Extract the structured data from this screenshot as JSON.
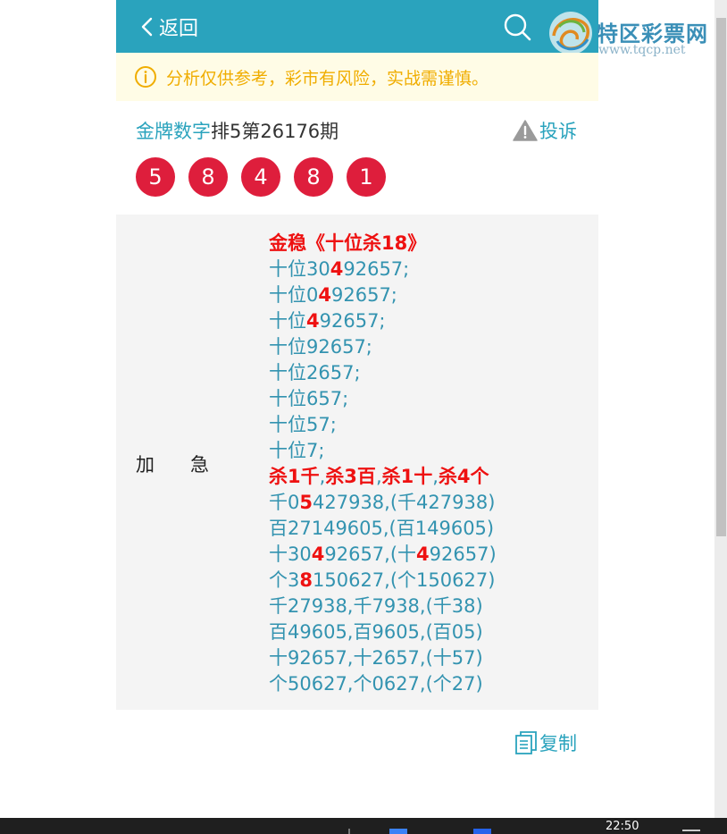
{
  "header": {
    "back_label": "返回",
    "bg_color": "#2aa3bd"
  },
  "watermark": {
    "name": "特区彩票网",
    "url": "www.tqcp.net"
  },
  "notice": {
    "text": "分析仅供参考，彩市有风险，实战需谨慎。",
    "icon": "info-circle-icon",
    "color": "#f0ad00"
  },
  "info": {
    "lottery_name": "金牌数字",
    "issue_text": "排5第26176期",
    "complain_label": "投诉"
  },
  "balls": [
    "5",
    "8",
    "4",
    "8",
    "1"
  ],
  "ball_color": "#de1e3c",
  "plan": {
    "tag": "加急",
    "title": "金稳《十位杀18》",
    "tens_lines": [
      {
        "pre": "十位30",
        "hi": "4",
        "post": "92657;"
      },
      {
        "pre": "十位0",
        "hi": "4",
        "post": "92657;"
      },
      {
        "pre": "十位",
        "hi": "4",
        "post": "92657;"
      },
      {
        "pre": "十位92657;",
        "hi": "",
        "post": ""
      },
      {
        "pre": "十位2657;",
        "hi": "",
        "post": ""
      },
      {
        "pre": "十位657;",
        "hi": "",
        "post": ""
      },
      {
        "pre": "十位57;",
        "hi": "",
        "post": ""
      },
      {
        "pre": "十位7;",
        "hi": "",
        "post": ""
      }
    ],
    "kill": {
      "k1": "杀1千",
      "k2": "杀3百",
      "k3": "杀1十",
      "k4": "杀4个",
      "sep": ","
    },
    "digit_lines": [
      {
        "pre": "千0",
        "hi": "5",
        "post": "427938,(千427938)"
      },
      {
        "pre": "百27149605,(百149605)",
        "hi": "",
        "post": ""
      },
      {
        "pre": "十30",
        "hi": "4",
        "post": "92657,(十",
        "hi2": "4",
        "post2": "92657)"
      },
      {
        "pre": "个3",
        "hi": "8",
        "post": "150627,(个150627)"
      },
      {
        "pre": "千27938,千7938,(千38)",
        "hi": "",
        "post": ""
      },
      {
        "pre": "百49605,百9605,(百05)",
        "hi": "",
        "post": ""
      },
      {
        "pre": "十92657,十2657,(十57)",
        "hi": "",
        "post": ""
      },
      {
        "pre": "个50627,个0627,(个27)",
        "hi": "",
        "post": ""
      }
    ]
  },
  "copy_label": "复制",
  "taskbar": {
    "time": "22:50"
  }
}
